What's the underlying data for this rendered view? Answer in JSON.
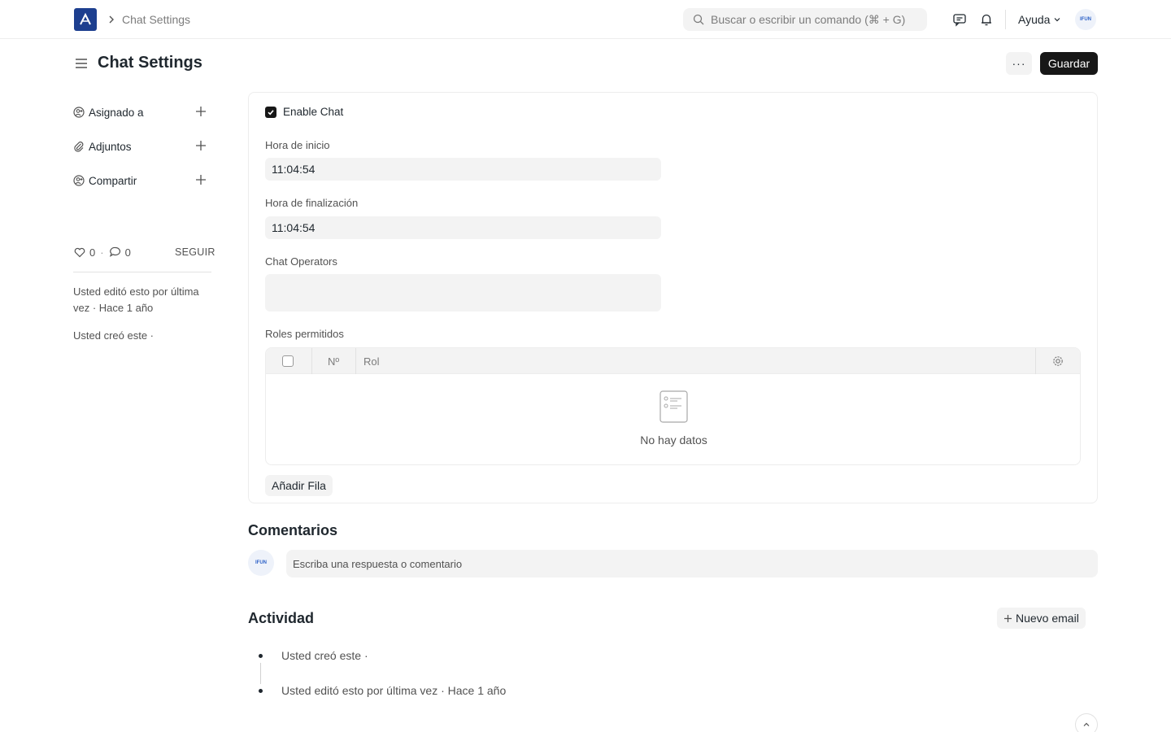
{
  "navbar": {
    "breadcrumb": "Chat Settings",
    "search_placeholder": "Buscar o escribir un comando (⌘ + G)",
    "help_label": "Ayuda",
    "avatar_text": "IFUN"
  },
  "page": {
    "title": "Chat Settings",
    "more_label": "···",
    "save_label": "Guardar"
  },
  "sidebar": {
    "items": [
      {
        "label": "Asignado a",
        "icon": "user-plus-icon"
      },
      {
        "label": "Adjuntos",
        "icon": "paperclip-icon"
      },
      {
        "label": "Compartir",
        "icon": "share-user-icon"
      }
    ],
    "likes_count": "0",
    "comments_count": "0",
    "follow_label": "SEGUIR",
    "last_edited": "Usted editó esto por última vez · Hace 1 año",
    "created": "Usted creó este ·"
  },
  "form": {
    "enable_chat_label": "Enable Chat",
    "enable_chat_checked": true,
    "start_time_label": "Hora de inicio",
    "start_time_value": "11:04:54",
    "end_time_label": "Hora de finalización",
    "end_time_value": "11:04:54",
    "operators_label": "Chat Operators",
    "roles_label": "Roles permitidos",
    "roles_table": {
      "columns": [
        "Nº",
        "Rol"
      ],
      "empty_text": "No hay datos"
    },
    "add_row_label": "Añadir Fila"
  },
  "comments": {
    "title": "Comentarios",
    "placeholder": "Escriba una respuesta o comentario",
    "avatar_text": "IFUN"
  },
  "activity": {
    "title": "Actividad",
    "new_email_label": "Nuevo email",
    "items": [
      "Usted creó este ·",
      "Usted editó esto por última vez · Hace 1 año"
    ]
  },
  "colors": {
    "brand": "#1d3f8f",
    "primary_button": "#171717",
    "control_bg": "#f3f3f3"
  }
}
